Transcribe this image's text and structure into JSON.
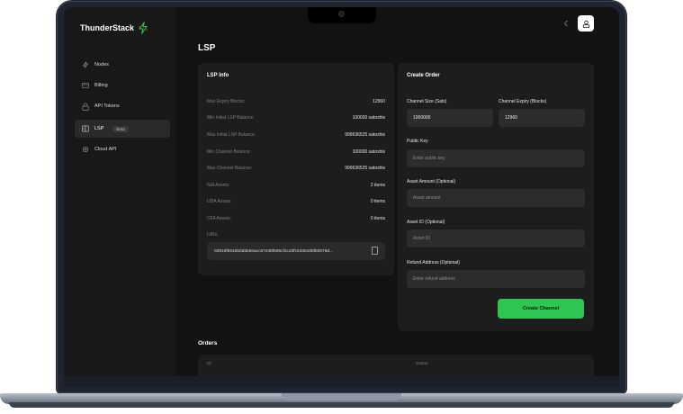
{
  "brand": {
    "name": "ThunderStack"
  },
  "sidebar": {
    "items": [
      {
        "label": "Nodes",
        "icon": "bolt-icon"
      },
      {
        "label": "Billing",
        "icon": "card-icon"
      },
      {
        "label": "API Tokens",
        "icon": "lock-icon"
      },
      {
        "label": "LSP",
        "icon": "map-icon",
        "badge": "Beta",
        "active": true
      },
      {
        "label": "Cloud API",
        "icon": "gear-icon"
      }
    ]
  },
  "header": {
    "theme_icon": "moon-icon",
    "user_icon": "user-icon"
  },
  "page": {
    "title": "LSP"
  },
  "lsp_info": {
    "title": "LSP Info",
    "rows": [
      {
        "key": "Max Expiry Blocks:",
        "value": "12960"
      },
      {
        "key": "Min Initial LSP Balance:",
        "value": "100000 satoshis"
      },
      {
        "key": "Max Initial LSP Balance:",
        "value": "999636525 satoshis"
      },
      {
        "key": "Min Channel Balance:",
        "value": "100000 satoshis"
      },
      {
        "key": "Max Channel Balance:",
        "value": "999636525 satoshis"
      },
      {
        "key": "NIA Assets:",
        "value": "2 items"
      },
      {
        "key": "UDA Assets:",
        "value": "0 items"
      },
      {
        "key": "CFA Assets:",
        "value": "0 items"
      }
    ],
    "uris_label": "URIs:",
    "uri": "03916f5916b0d5b50acc67e38f585cf2c23fc5338105f80076d..."
  },
  "create_order": {
    "title": "Create Order",
    "channel_size_label": "Channel Size (Sats)",
    "channel_size_value": "1000000",
    "channel_expiry_label": "Channel Expiry (Blocks)",
    "channel_expiry_value": "12960",
    "public_key_label": "Public Key",
    "public_key_placeholder": "Enter public key",
    "asset_amount_label": "Asset Amount (Optional)",
    "asset_amount_placeholder": "Asset amount",
    "asset_id_label": "Asset ID (Optional)",
    "asset_id_placeholder": "Asset ID",
    "refund_label": "Refund Address (Optional)",
    "refund_placeholder": "Enter refund address",
    "submit_label": "Create Channel"
  },
  "orders": {
    "title": "Orders",
    "columns": [
      "ID",
      "Status"
    ]
  },
  "colors": {
    "accent": "#2fc552",
    "background": "#121212",
    "card": "#1d1d1d",
    "sidebar": "#181818"
  }
}
